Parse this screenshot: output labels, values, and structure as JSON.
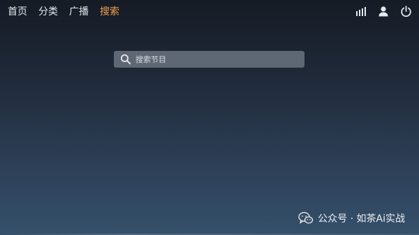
{
  "nav": {
    "items": [
      {
        "label": "首页",
        "active": false
      },
      {
        "label": "分类",
        "active": false
      },
      {
        "label": "广播",
        "active": false
      },
      {
        "label": "搜索",
        "active": true
      }
    ]
  },
  "status_icons": [
    "signal-icon",
    "user-icon",
    "power-icon"
  ],
  "search": {
    "placeholder": "搜索节目"
  },
  "watermark": {
    "text": "公众号 · 如茶Ai实战"
  },
  "colors": {
    "active_tab": "#f0a050",
    "search_bg": "#5e6874"
  }
}
